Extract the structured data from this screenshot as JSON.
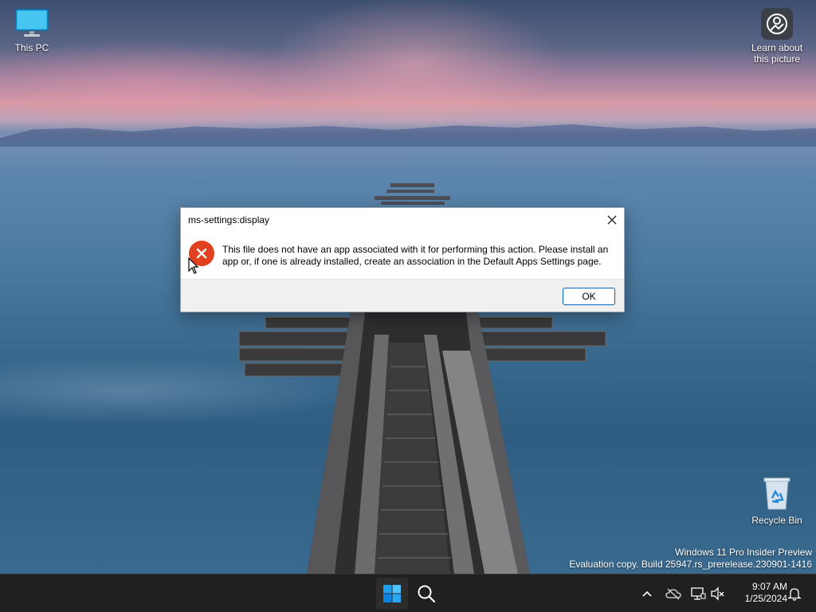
{
  "desktop": {
    "icons": [
      {
        "label": "This PC",
        "icon": "monitor-icon"
      },
      {
        "label": "Learn about this picture",
        "icon": "camera-info-icon"
      },
      {
        "label": "Recycle Bin",
        "icon": "recycle-bin-icon"
      }
    ],
    "watermark": {
      "line1": "Windows 11 Pro Insider Preview",
      "line2": "Evaluation copy. Build 25947.rs_prerelease.230901-1416"
    }
  },
  "dialog": {
    "title": "ms-settings:display",
    "message": "This file does not have an app associated with it for performing this action. Please install an app or, if one is already installed, create an association in the Default Apps Settings page.",
    "ok_label": "OK",
    "icon": "error-icon",
    "error_color": "#e0421f"
  },
  "taskbar": {
    "start_icon": "windows-start-icon",
    "search_icon": "search-icon",
    "tray": [
      "chevron-up-icon",
      "onedrive-offline-icon",
      "network-icon",
      "volume-muted-icon"
    ],
    "time": "9:07 AM",
    "date": "1/25/2024",
    "notification_icon": "bell-icon",
    "accent": "#0078d4"
  }
}
